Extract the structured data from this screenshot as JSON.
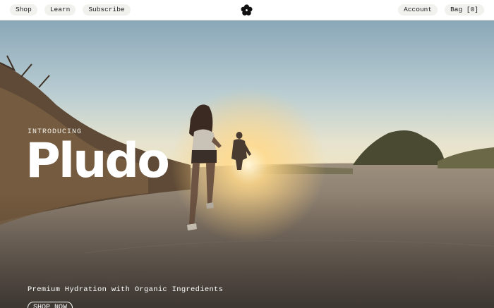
{
  "nav": {
    "left": [
      "Shop",
      "Learn",
      "Subscribe"
    ],
    "right": [
      "Account",
      "Bag [0]"
    ],
    "logo_icon": "flower-icon"
  },
  "hero": {
    "eyebrow": "INTRODUCING",
    "brand": "Pludo",
    "registered_mark": "®",
    "tagline": "Premium Hydration with Organic Ingredients",
    "cta": "SHOP NOW",
    "image": "runners-sunset-trail-photo"
  }
}
